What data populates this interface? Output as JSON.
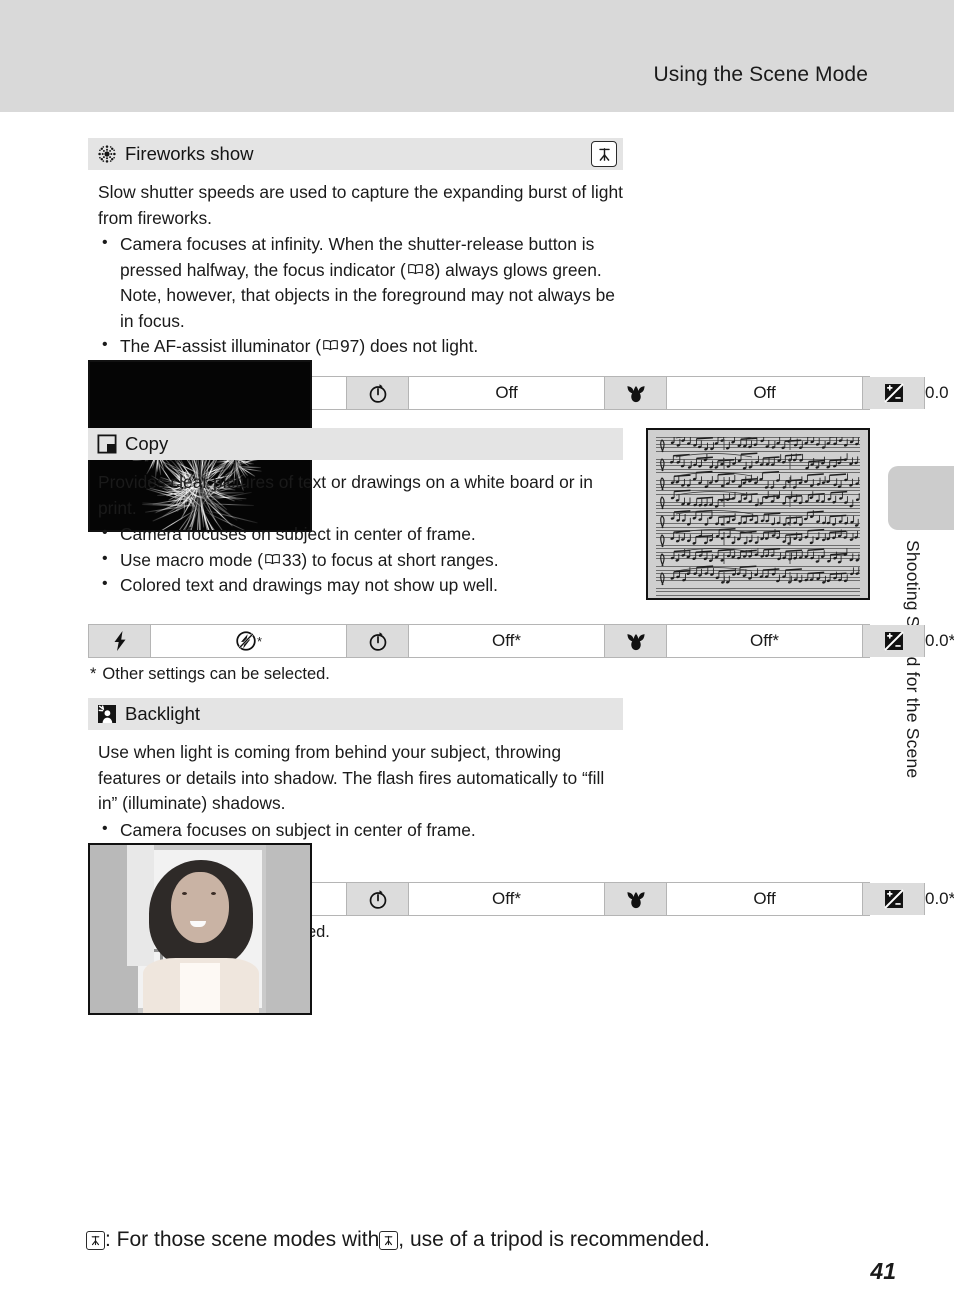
{
  "header": {
    "title": "Using the Scene Mode"
  },
  "side_tab": {
    "label": "Shooting Suited for the Scene"
  },
  "page_number": "41",
  "bottom_note": {
    "prefix_icon": "tripod-icon",
    "text_before": ": For those scene modes with ",
    "inline_icon": "tripod-icon",
    "text_after": ", use of a tripod is recommended."
  },
  "settings_columns": {
    "flash_label_icon": "flash-icon",
    "timer_label_icon": "self-timer-icon",
    "macro_label_icon": "macro-icon",
    "exposure_label_icon": "exposure-compensation-icon"
  },
  "sections": [
    {
      "id": "fireworks",
      "icon": "fireworks-icon",
      "title": "Fireworks show",
      "badge_icon": "tripod-icon",
      "has_badge": true,
      "intro": "Slow shutter speeds are used to capture the expanding burst of light from fireworks.",
      "bullets": [
        "Camera focuses at infinity. When the shutter-release button is pressed halfway, the focus indicator (↑ 8) always glows green. Note, however, that objects in the foreground may not always be in focus.",
        "The AF-assist illuminator (↑ 97) does not light."
      ],
      "bullet_parts": [
        {
          "before": "Camera focuses at infinity. When the shutter-release button is pressed halfway, the focus indicator (",
          "ref": "8",
          "after": ") always glows green. Note, however, that objects in the foreground may not always be in focus."
        },
        {
          "before": "The AF-assist illuminator (",
          "ref": "97",
          "after": ") does not light."
        }
      ],
      "photo": "fireworks-photo",
      "settings": {
        "flash": "flash-off-icon",
        "flash_star": false,
        "timer": "Off",
        "macro": "Off",
        "exposure": "0.0"
      },
      "footnote": null
    },
    {
      "id": "copy",
      "icon": "copy-icon",
      "title": "Copy",
      "has_badge": false,
      "intro": "Provides clear pictures of text or drawings on a white board or in print.",
      "bullet_parts": [
        {
          "before": "Camera focuses on subject in center of frame.",
          "ref": null,
          "after": ""
        },
        {
          "before": "Use macro mode (",
          "ref": "33",
          "after": ") to focus at short ranges."
        },
        {
          "before": "Colored text and drawings may not show up well.",
          "ref": null,
          "after": ""
        }
      ],
      "photo": "sheet-music-photo",
      "settings": {
        "flash": "flash-off-icon",
        "flash_star": true,
        "timer": "Off*",
        "macro": "Off*",
        "exposure": "0.0*"
      },
      "footnote": "Other settings can be selected."
    },
    {
      "id": "backlight",
      "icon": "backlight-icon",
      "title": "Backlight",
      "has_badge": false,
      "intro": "Use when light is coming from behind your subject, throwing features or details into shadow. The flash fires automatically to “fill in” (illuminate) shadows.",
      "bullet_parts": [
        {
          "before": "Camera focuses on subject in center of frame.",
          "ref": null,
          "after": ""
        }
      ],
      "photo": "backlight-portrait-photo",
      "settings": {
        "flash": "flash-fill-icon",
        "flash_star": false,
        "timer": "Off*",
        "macro": "Off",
        "exposure": "0.0*"
      },
      "footnote": "Other settings can be selected."
    }
  ],
  "colors": {
    "header_band": "#d9d9d9",
    "section_head": "#e4e4e4",
    "settings_label_cell": "#dcdcdc",
    "side_tab": "#cccccc",
    "text": "#1a1a1a"
  }
}
